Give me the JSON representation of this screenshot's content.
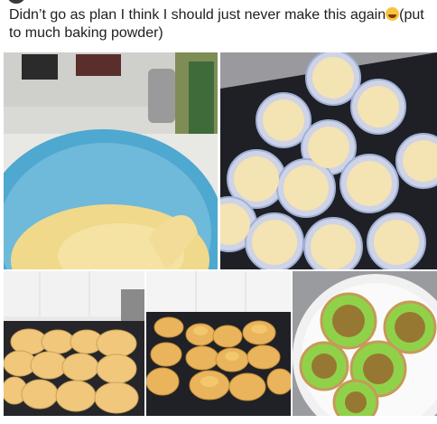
{
  "post": {
    "caption": "Didn’t go as plan I think I should just never make this again",
    "caption_suffix": "(put to much baking powder)",
    "emoji": "tears-of-joy-emoji",
    "photos": [
      "batter-bowl-photo",
      "batter-in-cupcake-cases-photo",
      "baked-cupcakes-tray-photo",
      "burst-cupcakes-tray-photo",
      "decorated-cupcakes-plate-photo"
    ]
  },
  "colors": {
    "text": "#1c1e21",
    "batter": "#f1d98a",
    "bowl": "#6fb6d6",
    "tray": "#1e1f24",
    "green_icing": "#8fd24a",
    "sprinkles": "#9a5a2c"
  }
}
